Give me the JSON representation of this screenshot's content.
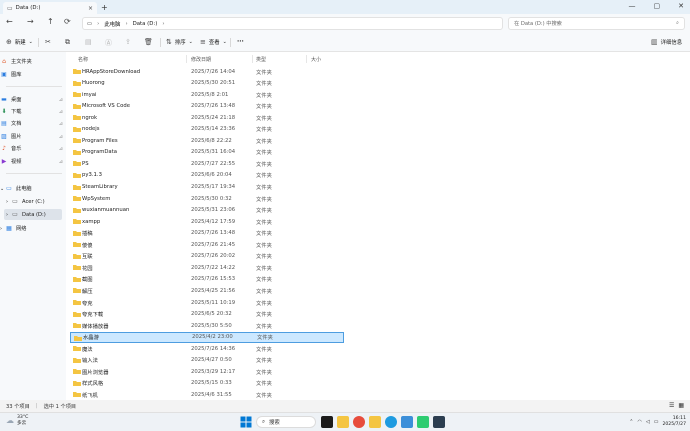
{
  "window": {
    "tab_title": "Data (D:)",
    "tab_close": "×",
    "tab_add": "+",
    "min": "—",
    "max": "▢",
    "close": "✕"
  },
  "address": {
    "crumbs": [
      "此电脑",
      "Data (D:)"
    ],
    "search_placeholder": "在 Data (D:) 中搜索"
  },
  "commandbar": {
    "new": "新建",
    "sort": "排序",
    "view": "查看",
    "more": "···",
    "details": "详细信息"
  },
  "sidebar": {
    "home": "主文件夹",
    "gallery": "图库",
    "desktop": "桌面",
    "downloads": "下载",
    "documents": "文档",
    "pictures": "图片",
    "music": "音乐",
    "videos": "视频",
    "this_pc": "此电脑",
    "acer": "Acer (C:)",
    "data": "Data (D:)",
    "network": "网络"
  },
  "columns": {
    "name": "名称",
    "date": "修改日期",
    "type": "类型",
    "size": "大小"
  },
  "files": [
    {
      "name": "HRAppStoreDownload",
      "date": "2025/7/26 14:04",
      "type": "文件夹"
    },
    {
      "name": "Huorong",
      "date": "2025/5/30 20:51",
      "type": "文件夹"
    },
    {
      "name": "imyai",
      "date": "2025/5/8 2:01",
      "type": "文件夹"
    },
    {
      "name": "Microsoft VS Code",
      "date": "2025/7/26 13:48",
      "type": "文件夹"
    },
    {
      "name": "ngrok",
      "date": "2025/5/24 21:18",
      "type": "文件夹"
    },
    {
      "name": "nodejs",
      "date": "2025/5/14 23:36",
      "type": "文件夹"
    },
    {
      "name": "Program Files",
      "date": "2025/6/8 22:22",
      "type": "文件夹"
    },
    {
      "name": "ProgramData",
      "date": "2025/5/31 16:04",
      "type": "文件夹"
    },
    {
      "name": "PS",
      "date": "2025/7/27 22:55",
      "type": "文件夹"
    },
    {
      "name": "py3.1.3",
      "date": "2025/6/6 20:04",
      "type": "文件夹"
    },
    {
      "name": "SteamLibrary",
      "date": "2025/5/17 19:34",
      "type": "文件夹"
    },
    {
      "name": "WpSystem",
      "date": "2025/5/30 0:32",
      "type": "文件夹"
    },
    {
      "name": "wuxianmuannuan",
      "date": "2025/5/31 23:06",
      "type": "文件夹"
    },
    {
      "name": "xampp",
      "date": "2025/4/12 17:59",
      "type": "文件夹"
    },
    {
      "name": "插稿",
      "date": "2025/7/26 13:48",
      "type": "文件夹"
    },
    {
      "name": "傻傻",
      "date": "2025/7/26 21:45",
      "type": "文件夹"
    },
    {
      "name": "互联",
      "date": "2025/7/26 20:02",
      "type": "文件夹"
    },
    {
      "name": "花园",
      "date": "2025/7/22 14:22",
      "type": "文件夹"
    },
    {
      "name": "截图",
      "date": "2025/7/26 15:53",
      "type": "文件夹"
    },
    {
      "name": "解压",
      "date": "2025/4/25 21:56",
      "type": "文件夹"
    },
    {
      "name": "夸克",
      "date": "2025/5/11 10:19",
      "type": "文件夹"
    },
    {
      "name": "夸克下载",
      "date": "2025/6/5 20:32",
      "type": "文件夹"
    },
    {
      "name": "媒体播放器",
      "date": "2025/5/30 5:50",
      "type": "文件夹"
    },
    {
      "name": "水晶游",
      "date": "2025/4/2 23:00",
      "type": "文件夹",
      "selected": true
    },
    {
      "name": "魔法",
      "date": "2025/7/26 14:36",
      "type": "文件夹"
    },
    {
      "name": "输入法",
      "date": "2025/4/27 0:50",
      "type": "文件夹"
    },
    {
      "name": "图片浏览器",
      "date": "2025/3/29 12:17",
      "type": "文件夹"
    },
    {
      "name": "样式风格",
      "date": "2025/5/15 0:33",
      "type": "文件夹"
    },
    {
      "name": "纸飞机",
      "date": "2025/4/6 31:55",
      "type": "文件夹"
    }
  ],
  "status": {
    "count": "33 个项目",
    "selected": "选中 1 个项目"
  },
  "taskbar": {
    "temp": "33°C",
    "weather": "多云",
    "search": "搜索",
    "time": "16:11",
    "date": "2025/7/27"
  },
  "colors": {
    "folder": "#f4c542",
    "selection_bg": "#cce8ff",
    "selection_border": "#4d9de0",
    "accent": "#0067c0"
  }
}
